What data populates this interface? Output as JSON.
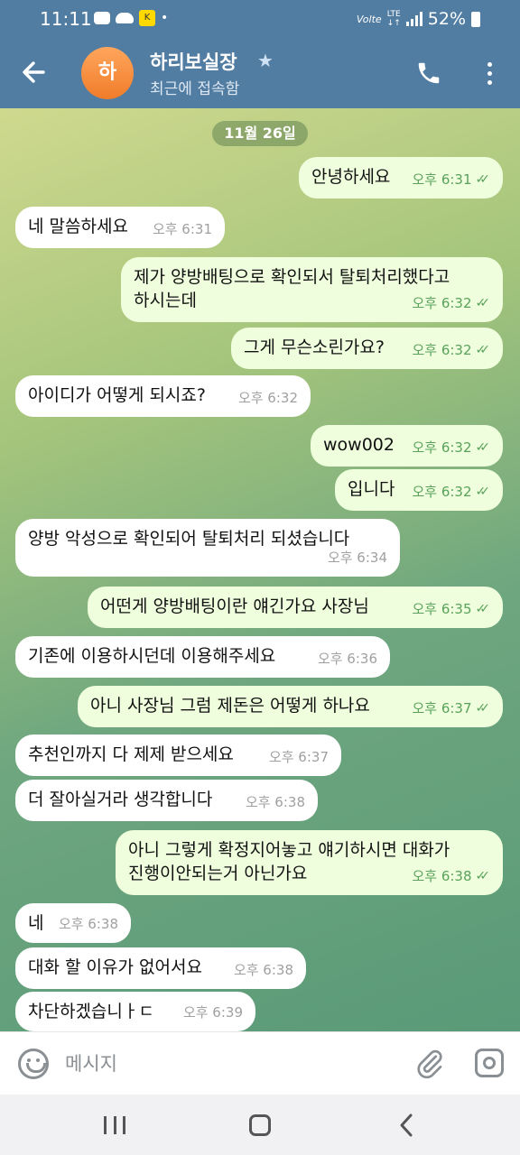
{
  "status_bar": {
    "time": "11:11",
    "app_badge": "K",
    "dot": "•",
    "network": "Volte",
    "lte": "LTE",
    "battery": "52%"
  },
  "header": {
    "avatar_letter": "하",
    "name": "하리보실장",
    "star": "★",
    "status": "최근에 접속함"
  },
  "chat": {
    "date": "11월 26일",
    "messages": [
      {
        "dir": "out",
        "text": "안녕하세요",
        "time": "오후 6:31",
        "read": true
      },
      {
        "dir": "in",
        "text": "네 말씀하세요",
        "time": "오후 6:31"
      },
      {
        "dir": "out",
        "text": "제가 양방배팅으로 확인되서 탈퇴처리했다고\n하시는데",
        "time": "오후 6:32",
        "read": true
      },
      {
        "dir": "out",
        "text": "그게 무슨소린가요?",
        "time": "오후 6:32",
        "read": true
      },
      {
        "dir": "in",
        "text": "아이디가 어떻게 되시죠?",
        "time": "오후 6:32"
      },
      {
        "dir": "out",
        "text": "wow002",
        "time": "오후 6:32",
        "read": true
      },
      {
        "dir": "out",
        "text": "입니다",
        "time": "오후 6:32",
        "read": true
      },
      {
        "dir": "in",
        "text": "양방 악성으로 확인되어 탈퇴처리 되셨습니다",
        "time": "오후 6:34"
      },
      {
        "dir": "out",
        "text": "어떤게 양방배팅이란 얘긴가요 사장님",
        "time": "오후 6:35",
        "read": true
      },
      {
        "dir": "in",
        "text": "기존에 이용하시던데 이용해주세요",
        "time": "오후 6:36"
      },
      {
        "dir": "out",
        "text": "아니 사장님 그럼 제돈은 어떻게 하나요",
        "time": "오후 6:37",
        "read": true
      },
      {
        "dir": "in",
        "text": "추천인까지 다 제제 받으세요",
        "time": "오후 6:37"
      },
      {
        "dir": "in",
        "text": "더 잘아실거라 생각합니다",
        "time": "오후 6:38"
      },
      {
        "dir": "out",
        "text": "아니 그렇게 확정지어놓고 얘기하시면 대화가\n진행이안되는거 아닌가요",
        "time": "오후 6:38",
        "read": true
      },
      {
        "dir": "in",
        "text": "네",
        "time": "오후 6:38"
      },
      {
        "dir": "in",
        "text": "대화 할 이유가 없어서요",
        "time": "오후 6:38"
      },
      {
        "dir": "in",
        "text": "차단하겠습니ㅏㄷ",
        "time": "오후 6:39"
      }
    ]
  },
  "input": {
    "placeholder": "메시지"
  },
  "colors": {
    "header": "#527da3",
    "bubble_out": "#effedd",
    "bubble_in": "#ffffff",
    "read_tick": "#5aa25b"
  },
  "icons": [
    "back-arrow-icon",
    "star-icon",
    "phone-icon",
    "more-vert-icon",
    "emoji-icon",
    "paperclip-icon",
    "camera-icon",
    "read-check-icon"
  ]
}
